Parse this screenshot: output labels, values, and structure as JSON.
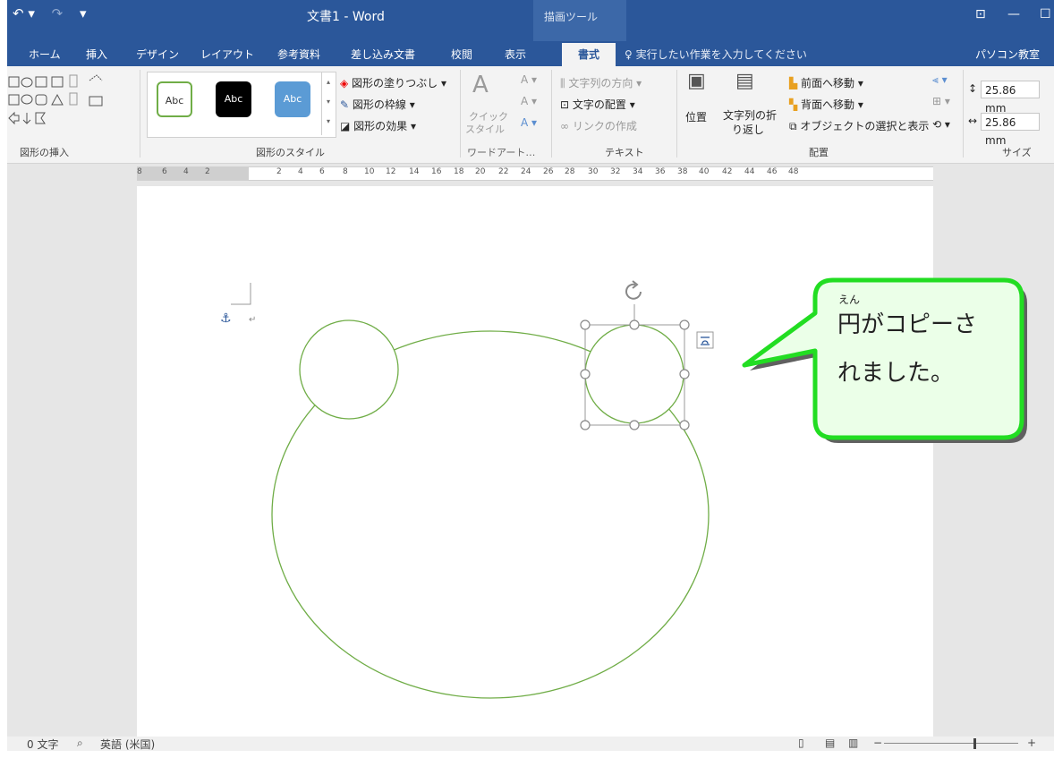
{
  "titlebar": {
    "title": "文書1 - Word",
    "context_tab": "描画ツール",
    "qat_undo": "↶ ▾",
    "qat_redo": "↷",
    "qat_customize": "▾",
    "ribbon_display": "⊡",
    "minimize": "—",
    "maximize": "☐"
  },
  "tabs": [
    {
      "label": "ホーム"
    },
    {
      "label": "挿入"
    },
    {
      "label": "デザイン"
    },
    {
      "label": "レイアウト"
    },
    {
      "label": "参考資料"
    },
    {
      "label": "差し込み文書"
    },
    {
      "label": "校閲"
    },
    {
      "label": "表示"
    },
    {
      "label": "書式"
    }
  ],
  "tellme": "実行したい作業を入力してください",
  "account": "パソコン教室",
  "ribbon": {
    "groups": {
      "insert_shapes": "図形の挿入",
      "shape_styles": "図形のスタイル",
      "wordart": "ワードアート…",
      "text": "テキスト",
      "arrange": "配置",
      "size": "サイズ"
    },
    "style_abc": "Abc",
    "fill": "図形の塗りつぶし",
    "outline": "図形の枠線",
    "effects": "図形の効果",
    "quick_style_1": "クイック",
    "quick_style_2": "スタイル",
    "text_direction": "文字列の方向",
    "text_align": "文字の配置",
    "create_link": "リンクの作成",
    "position": "位置",
    "wrap_1": "文字列の折",
    "wrap_2": "り返し",
    "bring_forward": "前面へ移動",
    "send_backward": "背面へ移動",
    "selection_pane": "オブジェクトの選択と表示",
    "height": "25.86 mm",
    "width": "25.86 mm"
  },
  "ruler": [
    "8",
    "6",
    "4",
    "2",
    "2",
    "4",
    "6",
    "8",
    "10",
    "12",
    "14",
    "16",
    "18",
    "20",
    "22",
    "24",
    "26",
    "28",
    "30",
    "32",
    "34",
    "36",
    "38",
    "40",
    "42",
    "44",
    "46",
    "48"
  ],
  "status": {
    "words": "0 文字",
    "language": "英語 (米国)"
  },
  "callout": {
    "ruby": "えん",
    "line1": "円がコピーさ",
    "line2": "れました。"
  },
  "colors": {
    "word_blue": "#2b579a",
    "shape_outline": "#70ad47",
    "callout_fill": "#ebffe8",
    "callout_border": "#22dd22"
  }
}
